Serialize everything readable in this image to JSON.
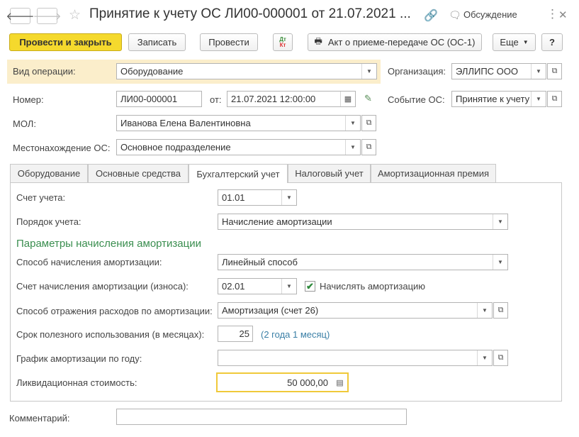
{
  "header": {
    "title": "Принятие к учету ОС ЛИ00-000001 от 21.07.2021 ...",
    "discuss_label": "Обсуждение",
    "more_icon": "⋮",
    "close_icon": "✕"
  },
  "toolbar": {
    "post_close": "Провести и закрыть",
    "save": "Записать",
    "post": "Провести",
    "dt": "Дт",
    "kt": "Кт",
    "act_label": "Акт о приеме-передаче ОС (ОС-1)",
    "more": "Еще",
    "help": "?"
  },
  "form": {
    "operation_label": "Вид операции:",
    "operation_value": "Оборудование",
    "org_label": "Организация:",
    "org_value": "ЭЛЛИПС ООО",
    "number_label": "Номер:",
    "number_value": "ЛИ00-000001",
    "date_label": "от:",
    "date_value": "21.07.2021 12:00:00",
    "event_label": "Событие ОС:",
    "event_value": "Принятие к учету",
    "mol_label": "МОЛ:",
    "mol_value": "Иванова Елена Валентиновна",
    "location_label": "Местонахождение ОС:",
    "location_value": "Основное подразделение",
    "comment_label": "Комментарий:",
    "comment_value": ""
  },
  "tabs": [
    {
      "label": "Оборудование"
    },
    {
      "label": "Основные средства"
    },
    {
      "label": "Бухгалтерский учет"
    },
    {
      "label": "Налоговый учет"
    },
    {
      "label": "Амортизационная премия"
    }
  ],
  "accounting": {
    "account_label": "Счет учета:",
    "account_value": "01.01",
    "order_label": "Порядок учета:",
    "order_value": "Начисление амортизации",
    "section_title": "Параметры начисления амортизации",
    "method_label": "Способ начисления амортизации:",
    "method_value": "Линейный способ",
    "depr_account_label": "Счет начисления амортизации (износа):",
    "depr_account_value": "02.01",
    "accrue_label": "Начислять амортизацию",
    "accrue_checked": true,
    "expense_label": "Способ отражения расходов по амортизации:",
    "expense_value": "Амортизация (счет 26)",
    "life_label": "Срок полезного использования (в месяцах):",
    "life_value": "25",
    "life_hint": "(2 года 1 месяц)",
    "schedule_label": "График амортизации по году:",
    "schedule_value": "",
    "liquidation_label": "Ликвидационная стоимость:",
    "liquidation_value": "50 000,00"
  }
}
